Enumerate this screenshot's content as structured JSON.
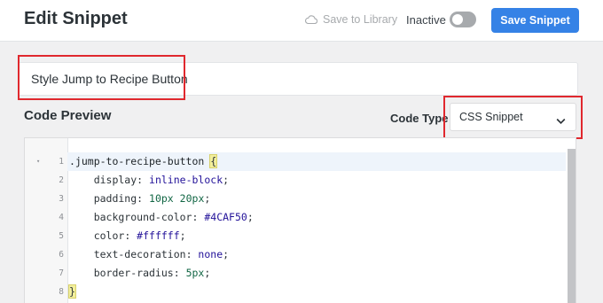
{
  "header": {
    "title": "Edit Snippet",
    "save_to_library_label": "Save to Library",
    "status_label": "Inactive",
    "active_toggle_on": false,
    "save_button_label": "Save Snippet"
  },
  "title_field": {
    "value": "Style Jump to Recipe Button"
  },
  "code_preview": {
    "heading": "Code Preview",
    "code_type_label": "Code Type",
    "code_type_value": "CSS Snippet"
  },
  "editor": {
    "line_numbers": [
      "1",
      "2",
      "3",
      "4",
      "5",
      "6",
      "7",
      "8"
    ],
    "lines": [
      [
        {
          "t": ".jump-to-recipe-button",
          "c": "selector"
        },
        {
          "t": " ",
          "c": "punct"
        },
        {
          "t": "{",
          "c": "brace-active"
        }
      ],
      [
        {
          "t": "    display",
          "c": "prop"
        },
        {
          "t": ": ",
          "c": "punct"
        },
        {
          "t": "inline-block",
          "c": "value"
        },
        {
          "t": ";",
          "c": "punct"
        }
      ],
      [
        {
          "t": "    padding",
          "c": "prop"
        },
        {
          "t": ": ",
          "c": "punct"
        },
        {
          "t": "10px",
          "c": "number"
        },
        {
          "t": " ",
          "c": "punct"
        },
        {
          "t": "20px",
          "c": "number"
        },
        {
          "t": ";",
          "c": "punct"
        }
      ],
      [
        {
          "t": "    background-color",
          "c": "prop"
        },
        {
          "t": ": ",
          "c": "punct"
        },
        {
          "t": "#4CAF50",
          "c": "value"
        },
        {
          "t": ";",
          "c": "punct"
        }
      ],
      [
        {
          "t": "    color",
          "c": "prop"
        },
        {
          "t": ": ",
          "c": "punct"
        },
        {
          "t": "#ffffff",
          "c": "value"
        },
        {
          "t": ";",
          "c": "punct"
        }
      ],
      [
        {
          "t": "    text-decoration",
          "c": "prop"
        },
        {
          "t": ": ",
          "c": "punct"
        },
        {
          "t": "none",
          "c": "value"
        },
        {
          "t": ";",
          "c": "punct"
        }
      ],
      [
        {
          "t": "    border-radius",
          "c": "prop"
        },
        {
          "t": ": ",
          "c": "punct"
        },
        {
          "t": "5px",
          "c": "number"
        },
        {
          "t": ";",
          "c": "punct"
        }
      ],
      [
        {
          "t": "}",
          "c": "brace-active"
        }
      ]
    ]
  },
  "colors": {
    "accent": "#3582e6",
    "highlight_border": "#e0282e"
  }
}
